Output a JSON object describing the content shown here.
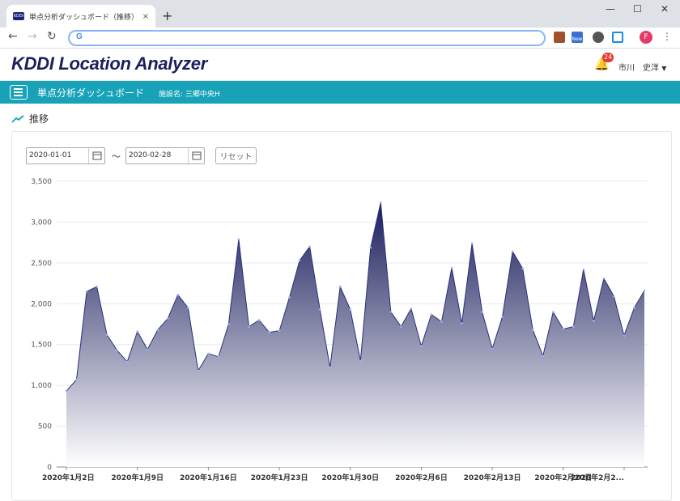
{
  "browser": {
    "tab_title": "単点分析ダッシュボード（推移） - K",
    "tab_favicon_text": "KDDI",
    "close_glyph": "×",
    "newtab_glyph": "+",
    "window_controls": [
      "—",
      "☐",
      "✕"
    ],
    "profile_initial": "F",
    "extension_new_badge": "New"
  },
  "app": {
    "brand": "KDDI Location Analyzer",
    "notification_count": "24",
    "user_name": "市川　史洋"
  },
  "page": {
    "title": "単点分析ダッシュボード",
    "facility_label": "施設名: 三郷中央H",
    "section_title": "推移"
  },
  "filters": {
    "start_date": "2020-01-01",
    "end_date": "2020-02-28",
    "separator": "～",
    "reset_label": "リセット"
  },
  "colors": {
    "teal": "#17a2b8",
    "brand_navy": "#1a1f5e",
    "area_top": "#1b1e5c",
    "area_bottom": "#ffffff"
  },
  "chart_data": {
    "type": "area",
    "ylim": [
      0,
      3500
    ],
    "yticks": [
      "0",
      "500",
      "1,000",
      "1,500",
      "2,000",
      "2,500",
      "3,000",
      "3,500"
    ],
    "ytick_values": [
      0,
      500,
      1000,
      1500,
      2000,
      2500,
      3000,
      3500
    ],
    "xtick_labels": [
      "2020年1月2日",
      "2020年1月9日",
      "2020年1月16日",
      "2020年1月23日",
      "2020年1月30日",
      "2020年2月6日",
      "2020年2月13日",
      "2020年2月20日",
      "2020年2月2..."
    ],
    "xtick_indices": [
      0,
      7,
      14,
      21,
      28,
      35,
      42,
      49,
      55
    ],
    "x": [
      "2020-01-02",
      "2020-01-03",
      "2020-01-04",
      "2020-01-05",
      "2020-01-06",
      "2020-01-07",
      "2020-01-08",
      "2020-01-09",
      "2020-01-10",
      "2020-01-11",
      "2020-01-12",
      "2020-01-13",
      "2020-01-14",
      "2020-01-15",
      "2020-01-16",
      "2020-01-17",
      "2020-01-18",
      "2020-01-19",
      "2020-01-20",
      "2020-01-21",
      "2020-01-22",
      "2020-01-23",
      "2020-01-24",
      "2020-01-25",
      "2020-01-26",
      "2020-01-27",
      "2020-01-28",
      "2020-01-29",
      "2020-01-30",
      "2020-01-31",
      "2020-02-01",
      "2020-02-02",
      "2020-02-03",
      "2020-02-04",
      "2020-02-05",
      "2020-02-06",
      "2020-02-07",
      "2020-02-08",
      "2020-02-09",
      "2020-02-10",
      "2020-02-11",
      "2020-02-12",
      "2020-02-13",
      "2020-02-14",
      "2020-02-15",
      "2020-02-16",
      "2020-02-17",
      "2020-02-18",
      "2020-02-19",
      "2020-02-20",
      "2020-02-21",
      "2020-02-22",
      "2020-02-23",
      "2020-02-24",
      "2020-02-25",
      "2020-02-26",
      "2020-02-27",
      "2020-02-28"
    ],
    "values": [
      930,
      1070,
      2150,
      2210,
      1620,
      1430,
      1290,
      1660,
      1440,
      1680,
      1820,
      2110,
      1950,
      1180,
      1390,
      1350,
      1750,
      2790,
      1720,
      1800,
      1650,
      1670,
      2080,
      2530,
      2700,
      1930,
      1220,
      2210,
      1930,
      1300,
      2690,
      3240,
      1900,
      1720,
      1940,
      1480,
      1870,
      1780,
      2440,
      1760,
      2740,
      1900,
      1450,
      1840,
      2640,
      2430,
      1680,
      1360,
      1900,
      1690,
      1720,
      2420,
      1790,
      2310,
      2090,
      1610,
      1950,
      2160
    ]
  }
}
